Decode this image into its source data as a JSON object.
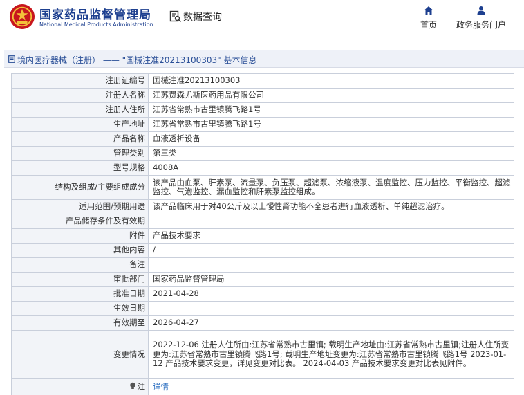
{
  "header": {
    "brand_cn": "国家药品监督管理局",
    "brand_en": "National Medical Products Administration",
    "query_title": "数据查询",
    "nav": {
      "home": "首页",
      "service": "政务服务门户"
    }
  },
  "colors": {
    "brand": "#1d3f8f",
    "link": "#2a6ec0",
    "emblem": "#c8161d"
  },
  "title_bar": {
    "text": "境内医疗器械（注册） ——  \"国械注准20213100303\"  基本信息"
  },
  "rows": [
    {
      "label": "注册证编号",
      "value": "国械注准20213100303"
    },
    {
      "label": "注册人名称",
      "value": "江苏费森尤斯医药用品有限公司"
    },
    {
      "label": "注册人住所",
      "value": "江苏省常熟市古里镇腾飞路1号"
    },
    {
      "label": "生产地址",
      "value": "江苏省常熟市古里镇腾飞路1号"
    },
    {
      "label": "产品名称",
      "value": "血液透析设备"
    },
    {
      "label": "管理类别",
      "value": "第三类"
    },
    {
      "label": "型号规格",
      "value": "4008A"
    },
    {
      "label": "结构及组成/主要组成成分",
      "value": "该产品由血泵、肝素泵、流量泵、负压泵、超滤泵、浓缩液泵、温度监控、压力监控、平衡监控、超滤监控、气泡监控、漏血监控和肝素泵监控组成。"
    },
    {
      "label": "适用范围/预期用途",
      "value": "该产品临床用于对40公斤及以上慢性肾功能不全患者进行血液透析、单纯超滤治疗。"
    },
    {
      "label": "产品储存条件及有效期",
      "value": ""
    },
    {
      "label": "附件",
      "value": "产品技术要求"
    },
    {
      "label": "其他内容",
      "value": "/"
    },
    {
      "label": "备注",
      "value": ""
    },
    {
      "label": "审批部门",
      "value": "国家药品监督管理局"
    },
    {
      "label": "批准日期",
      "value": "2021-04-28"
    },
    {
      "label": "生效日期",
      "value": ""
    },
    {
      "label": "有效期至",
      "value": "2026-04-27"
    },
    {
      "label": "变更情况",
      "value": "2022-12-06 注册人住所由:江苏省常熟市古里镇; 载明生产地址由:江苏省常熟市古里镇;注册人住所变更为:江苏省常熟市古里镇腾飞路1号; 载明生产地址变更为:江苏省常熟市古里镇腾飞路1号 2023-01-12 产品技术要求变更，详见变更对比表。 2024-04-03 产品技术要求变更对比表见附件。"
    },
    {
      "label": "注",
      "value": "详情"
    }
  ],
  "icons": {
    "emblem": "national-emblem-icon",
    "query": "search-document-icon",
    "home": "home-icon",
    "service": "user-icon",
    "title": "document-icon",
    "note": "lightbulb-icon"
  }
}
